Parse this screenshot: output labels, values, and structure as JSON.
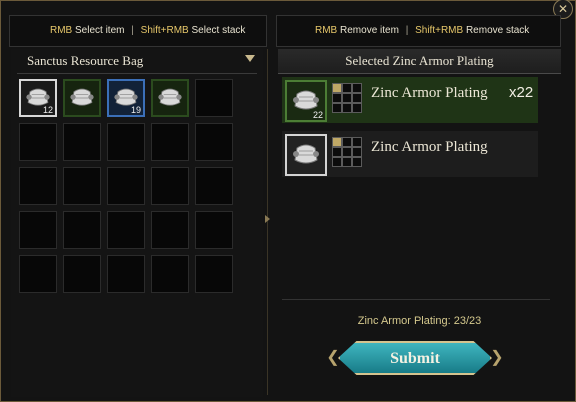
{
  "hints": {
    "left": {
      "key1": "RMB",
      "text1": "Select item",
      "key2": "Shift+RMB",
      "text2": "Select stack"
    },
    "right": {
      "key1": "RMB",
      "text1": "Remove item",
      "key2": "Shift+RMB",
      "text2": "Remove stack"
    }
  },
  "bag": {
    "title": "Sanctus Resource Bag",
    "slots": [
      {
        "icon": "armor-plating-icon",
        "rarity": "white",
        "count": "12"
      },
      {
        "icon": "armor-plating-icon",
        "rarity": "green",
        "count": ""
      },
      {
        "icon": "armor-plating-icon",
        "rarity": "blue",
        "count": "19"
      },
      {
        "icon": "armor-plating-icon",
        "rarity": "green",
        "count": ""
      }
    ]
  },
  "selected": {
    "title": "Selected Zinc Armor Plating",
    "rows": [
      {
        "name": "Zinc Armor Plating",
        "qty": "x22",
        "count": "22",
        "rarity": "green"
      },
      {
        "name": "Zinc Armor Plating",
        "qty": "",
        "count": "",
        "rarity": "white"
      }
    ],
    "progress": "Zinc Armor Plating: 23/23",
    "submit_label": "Submit"
  },
  "colors": {
    "accent_gold": "#d5c98e",
    "submit_teal": "#2aa0ab",
    "frame": "#6b5a3a"
  }
}
